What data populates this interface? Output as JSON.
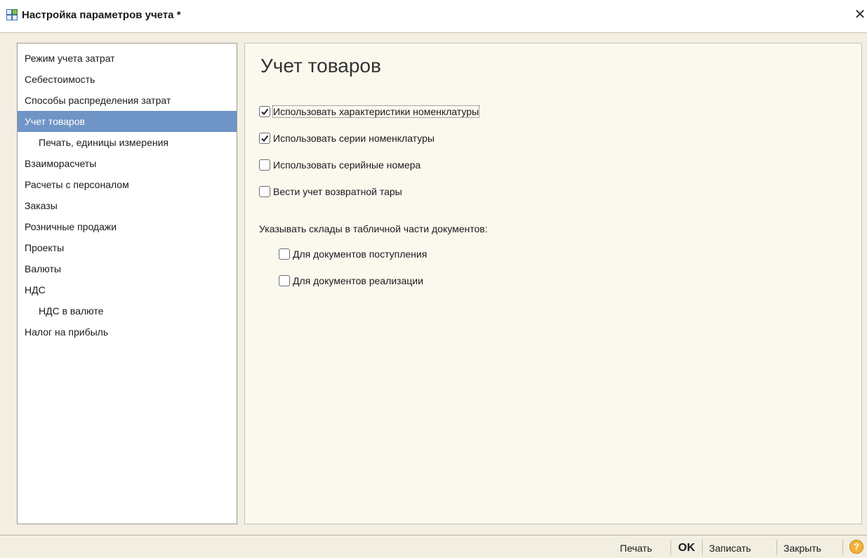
{
  "window": {
    "title": "Настройка параметров учета",
    "modified_marker": "*",
    "close_glyph": "✕"
  },
  "sidebar": {
    "items": [
      {
        "label": "Режим учета затрат"
      },
      {
        "label": "Себестоимость"
      },
      {
        "label": "Способы распределения затрат"
      },
      {
        "label": "Учет товаров",
        "selected": true
      },
      {
        "label": "Печать, единицы измерения",
        "indent": true
      },
      {
        "label": "Взаиморасчеты"
      },
      {
        "label": "Расчеты с персоналом"
      },
      {
        "label": "Заказы"
      },
      {
        "label": "Розничные продажи"
      },
      {
        "label": "Проекты"
      },
      {
        "label": "Валюты"
      },
      {
        "label": "НДС"
      },
      {
        "label": "НДС в валюте",
        "indent": true
      },
      {
        "label": "Налог на прибыль"
      }
    ]
  },
  "main": {
    "title": "Учет товаров",
    "options": [
      {
        "label": "Использовать характеристики номенклатуры",
        "checked": true
      },
      {
        "label": "Использовать серии номенклатуры",
        "checked": true
      },
      {
        "label": "Использовать серийные номера",
        "checked": false
      },
      {
        "label": "Вести учет возвратной тары",
        "checked": false
      }
    ],
    "warehouses_label": "Указывать склады в табличной части документов:",
    "warehouse_options": [
      {
        "label": "Для документов поступления",
        "checked": false
      },
      {
        "label": "Для документов реализации",
        "checked": false
      }
    ]
  },
  "toolbar": {
    "print_label": "Печать",
    "ok_label": "OK",
    "save_label": "Записать",
    "close_label": "Закрыть",
    "help_glyph": "?"
  },
  "colors": {
    "selection": "#6f94c6",
    "form_background": "#f2eee2",
    "content_background": "#fbf8ee"
  }
}
